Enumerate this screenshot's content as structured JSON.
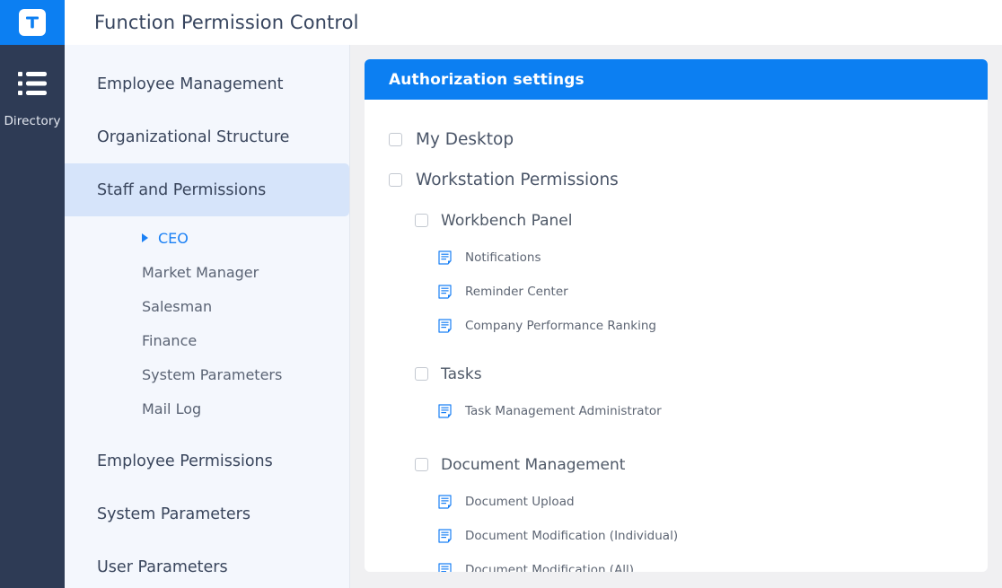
{
  "rail": {
    "logo_icon": "t-logo-icon",
    "item": {
      "icon": "list-icon",
      "label": "Directory"
    }
  },
  "topbar": {
    "title": "Function Permission Control"
  },
  "nav": {
    "items": [
      {
        "label": "Employee Management",
        "active": false
      },
      {
        "label": "Organizational Structure",
        "active": false
      },
      {
        "label": "Staff and Permissions",
        "active": true
      },
      {
        "label": "Employee Permissions",
        "active": false
      },
      {
        "label": "System Parameters",
        "active": false
      },
      {
        "label": "User Parameters",
        "active": false
      }
    ],
    "sub_items": [
      {
        "label": "CEO",
        "active": true
      },
      {
        "label": "Market Manager",
        "active": false
      },
      {
        "label": "Salesman",
        "active": false
      },
      {
        "label": "Finance",
        "active": false
      },
      {
        "label": "System Parameters",
        "active": false
      },
      {
        "label": "Mail Log",
        "active": false
      }
    ]
  },
  "card": {
    "header_title": "Authorization settings",
    "tree": [
      {
        "level": 0,
        "type": "checkbox",
        "label": "My Desktop",
        "checked": false
      },
      {
        "level": 0,
        "type": "checkbox",
        "label": "Workstation Permissions",
        "checked": false
      },
      {
        "level": 1,
        "type": "checkbox",
        "label": "Workbench Panel",
        "checked": false
      },
      {
        "level": 2,
        "type": "doc",
        "label": "Notifications",
        "icon": "document-icon"
      },
      {
        "level": 2,
        "type": "doc",
        "label": "Reminder Center",
        "icon": "document-icon"
      },
      {
        "level": 2,
        "type": "doc",
        "label": "Company Performance Ranking",
        "icon": "document-icon"
      },
      {
        "level": 1,
        "type": "checkbox",
        "label": "Tasks",
        "checked": false
      },
      {
        "level": 2,
        "type": "doc",
        "label": "Task Management Administrator",
        "icon": "document-icon"
      },
      {
        "level": 1,
        "type": "checkbox",
        "label": "Document Management",
        "checked": false
      },
      {
        "level": 2,
        "type": "doc",
        "label": "Document Upload",
        "icon": "document-icon"
      },
      {
        "level": 2,
        "type": "doc",
        "label": "Document Modification (Individual)",
        "icon": "document-icon"
      },
      {
        "level": 2,
        "type": "doc",
        "label": "Document Modification (All)",
        "icon": "document-icon"
      }
    ]
  },
  "colors": {
    "accent_blue": "#0c7ff2",
    "rail_navy": "#2e3b55",
    "nav_bg": "#f4f7fd",
    "nav_active": "#d6e4fa",
    "link_blue": "#1a80f5"
  }
}
